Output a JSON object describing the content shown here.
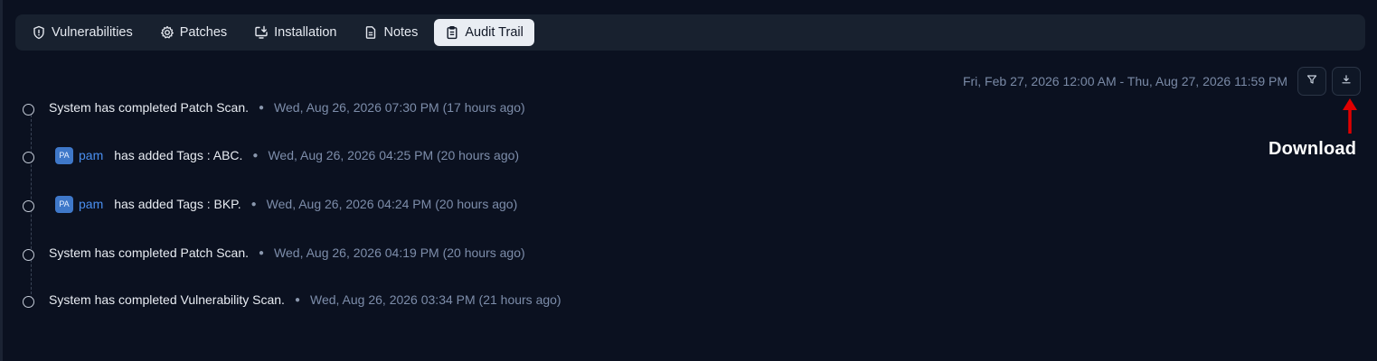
{
  "tabs": [
    {
      "label": "Vulnerabilities",
      "icon": "shield-icon",
      "active": false
    },
    {
      "label": "Patches",
      "icon": "gear-icon",
      "active": false
    },
    {
      "label": "Installation",
      "icon": "install-icon",
      "active": false
    },
    {
      "label": "Notes",
      "icon": "document-icon",
      "active": false
    },
    {
      "label": "Audit Trail",
      "icon": "clipboard-icon",
      "active": true
    }
  ],
  "toolbar": {
    "date_range": "Fri, Feb 27, 2026 12:00 AM - Thu, Aug 27, 2026 11:59 PM",
    "filter_icon": "filter-icon",
    "download_icon": "download-icon"
  },
  "annotation": {
    "label": "Download",
    "color": "#e00000"
  },
  "timeline": [
    {
      "text": "System has completed Patch Scan.",
      "time": "Wed, Aug 26, 2026 07:30 PM (17 hours ago)"
    },
    {
      "avatar": "PA",
      "user": "pam",
      "text": "has added Tags : ABC.",
      "time": "Wed, Aug 26, 2026 04:25 PM (20 hours ago)"
    },
    {
      "avatar": "PA",
      "user": "pam",
      "text": "has added Tags : BKP.",
      "time": "Wed, Aug 26, 2026 04:24 PM (20 hours ago)"
    },
    {
      "text": "System has completed Patch Scan.",
      "time": "Wed, Aug 26, 2026 04:19 PM (20 hours ago)"
    },
    {
      "text": "System has completed Vulnerability Scan.",
      "time": "Wed, Aug 26, 2026 03:34 PM (21 hours ago)"
    }
  ],
  "colors": {
    "background": "#0b1120",
    "tabbar": "#18212f",
    "active_tab": "#e9edf3",
    "user_link": "#4a8ff0",
    "avatar": "#3f78c9"
  }
}
